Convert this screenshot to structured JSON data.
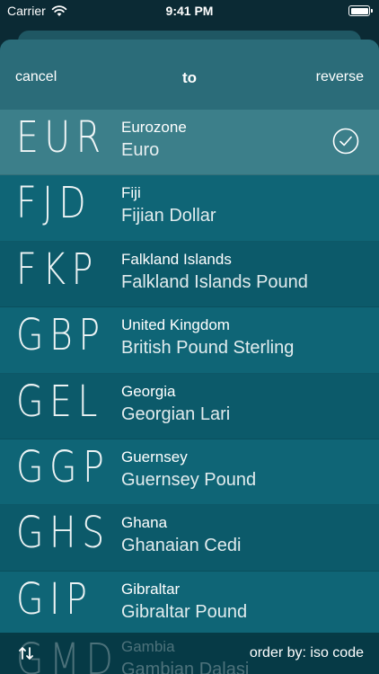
{
  "status_bar": {
    "carrier": "Carrier",
    "time": "9:41 PM"
  },
  "nav": {
    "cancel_label": "cancel",
    "title": "to",
    "reverse_label": "reverse"
  },
  "currencies": [
    {
      "code": "EUR",
      "country": "Eurozone",
      "currency": "Euro",
      "selected": true
    },
    {
      "code": "FJD",
      "country": "Fiji",
      "currency": "Fijian Dollar",
      "selected": false
    },
    {
      "code": "FKP",
      "country": "Falkland Islands",
      "currency": "Falkland Islands Pound",
      "selected": false
    },
    {
      "code": "GBP",
      "country": "United Kingdom",
      "currency": "British Pound Sterling",
      "selected": false
    },
    {
      "code": "GEL",
      "country": "Georgia",
      "currency": "Georgian Lari",
      "selected": false
    },
    {
      "code": "GGP",
      "country": "Guernsey",
      "currency": "Guernsey Pound",
      "selected": false
    },
    {
      "code": "GHS",
      "country": "Ghana",
      "currency": "Ghanaian Cedi",
      "selected": false
    },
    {
      "code": "GIP",
      "country": "Gibraltar",
      "currency": "Gibraltar Pound",
      "selected": false
    }
  ],
  "peek": {
    "code": "GMD",
    "country": "Gambia",
    "currency": "Gambian Dalasi"
  },
  "bottom_bar": {
    "order_label": "order by: iso code",
    "sort_icon": "sort-arrows-icon"
  },
  "colors": {
    "selected_row": "#3c7f8a",
    "row": "#0c5a6a",
    "nav": "#2b6c79"
  }
}
